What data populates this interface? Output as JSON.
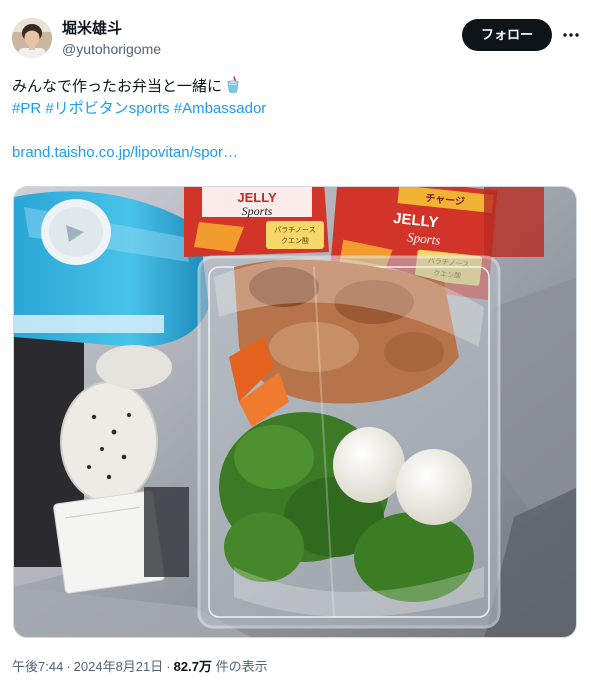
{
  "user": {
    "display_name": "堀米雄斗",
    "handle": "@yutohorigome"
  },
  "header": {
    "follow_label": "フォロー",
    "more_icon": "more-horizontal-icon"
  },
  "tweet": {
    "text": "みんなで作ったお弁当と一緒に",
    "text_icon": "tropical-drink-icon",
    "hashtags": [
      "#PR",
      "#リポビタンsports",
      "#Ambassador"
    ],
    "link": "brand.taisho.co.jp/lipovitan/spor…"
  },
  "photo": {
    "product_lines": [
      "JELLY",
      "Sports",
      "パラチノース",
      "クエン酸",
      "チャージ"
    ]
  },
  "meta": {
    "time": "午後7:44",
    "separator": "·",
    "date": "2024年8月21日",
    "views_count": "82.7万",
    "views_label": "件の表示"
  },
  "colors": {
    "accent": "#1d9bf0",
    "text": "#0f1419",
    "secondary": "#536471",
    "follow_bg": "#0f1419"
  }
}
